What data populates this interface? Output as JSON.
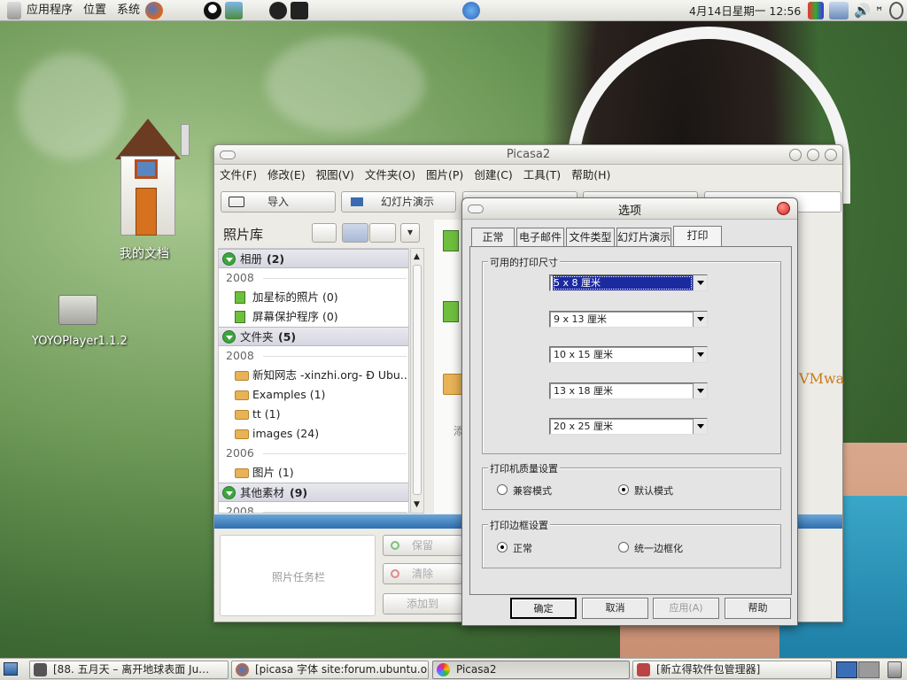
{
  "top_panel": {
    "menus": [
      "应用程序",
      "位置",
      "系统"
    ],
    "clock": "4月14日星期一 12:56"
  },
  "desktop": {
    "icons": [
      {
        "label": "我的文档",
        "icon": "home-icon"
      },
      {
        "label": "YOYOPlayer1.1.2",
        "icon": "folder-icon"
      }
    ]
  },
  "picasa": {
    "title": "Picasa2",
    "menu": [
      "文件(F)",
      "修改(E)",
      "视图(V)",
      "文件夹(O)",
      "图片(P)",
      "创建(C)",
      "工具(T)",
      "帮助(H)"
    ],
    "toolbar": {
      "import": "导入",
      "slideshow": "幻灯片演示"
    },
    "sidebar_title": "照片库",
    "tree": [
      {
        "type": "header",
        "label": "相册",
        "count": "(2)"
      },
      {
        "type": "year",
        "label": "2008"
      },
      {
        "type": "album",
        "label": "加星标的照片 (0)"
      },
      {
        "type": "album",
        "label": "屏幕保护程序 (0)"
      },
      {
        "type": "header",
        "label": "文件夹",
        "count": "(5)"
      },
      {
        "type": "year",
        "label": "2008"
      },
      {
        "type": "folder",
        "label": "新知网志 -xinzhi.org- Ð Ubu..."
      },
      {
        "type": "folder",
        "label": "Examples (1)"
      },
      {
        "type": "folder",
        "label": "tt (1)"
      },
      {
        "type": "folder",
        "label": "images (24)"
      },
      {
        "type": "year",
        "label": "2006"
      },
      {
        "type": "folder",
        "label": "图片 (1)"
      },
      {
        "type": "header",
        "label": "其他素材",
        "count": "(9)"
      },
      {
        "type": "year",
        "label": "2008"
      }
    ],
    "tray_label": "照片任务栏",
    "tray_actions": [
      "保留",
      "清除",
      "添加到"
    ],
    "side_text": "VMwa",
    "partial_label": "添"
  },
  "dialog": {
    "title": "选项",
    "tabs": [
      "正常",
      "电子邮件",
      "文件类型",
      "幻灯片演示",
      "打印"
    ],
    "group_sizes": "可用的打印尺寸",
    "sizes": [
      "5 x 8 厘米",
      "9 x 13 厘米",
      "10 x 15 厘米",
      "13 x 18 厘米",
      "20 x 25 厘米"
    ],
    "group_printer": "打印机质量设置",
    "printer_options": [
      "兼容模式",
      "默认模式"
    ],
    "group_border": "打印边框设置",
    "border_options": [
      "正常",
      "统一边框化"
    ],
    "buttons": {
      "ok": "确定",
      "cancel": "取消",
      "apply": "应用(A)",
      "help": "帮助"
    }
  },
  "taskbar": [
    {
      "label": "[88. 五月天 – 离开地球表面 Ju…",
      "icon": "player-icon"
    },
    {
      "label": "[picasa 字体 site:forum.ubuntu.o…",
      "icon": "firefox-icon"
    },
    {
      "label": "Picasa2",
      "icon": "picasa-icon"
    },
    {
      "label": "[新立得软件包管理器]",
      "icon": "package-icon"
    }
  ],
  "colors": {
    "accent": "#1c2aa0",
    "desktop": "#6f9a58"
  }
}
